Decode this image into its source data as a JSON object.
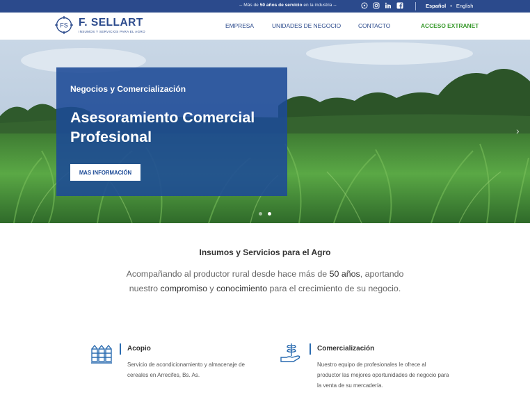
{
  "topbar": {
    "tagline_pre": "-- Más de",
    "tagline_bold": "50 años de servicio",
    "tagline_post": "en la industria --",
    "social": [
      "whatsapp-icon",
      "instagram-icon",
      "linkedin-icon",
      "facebook-icon"
    ],
    "lang_active": "Español",
    "lang_sep": "•",
    "lang_other": "English"
  },
  "header": {
    "logo_initials": "FS",
    "logo_name": "F. SELLART",
    "logo_sub": "INSUMOS Y SERVICIOS PARA EL AGRO",
    "nav": [
      "EMPRESA",
      "UNIDADES DE NEGOCIO",
      "CONTACTO",
      "ACCESO EXTRANET"
    ]
  },
  "hero": {
    "kicker": "Negocios y Comercialización",
    "title": "Asesoramiento Comercial Profesional",
    "button": "MAS INFORMACIÓN",
    "slide_count": 2,
    "active_slide": 1,
    "next_arrow": "›"
  },
  "intro": {
    "title": "Insumos y Servicios para el Agro",
    "t1": "Acompañando al productor rural desde hace más de ",
    "h1": "50 años",
    "t2": ", aportando nuestro ",
    "h2": "compromiso",
    "t3": " y ",
    "h3": "conocimiento",
    "t4": " para el crecimiento de su negocio."
  },
  "services": [
    {
      "icon": "silo-icon",
      "title": "Acopio",
      "desc": "Servicio de acondicionamiento y almacenaje de cereales en Arrecifes, Bs. As."
    },
    {
      "icon": "plant-hand-icon",
      "title": "Comercialización",
      "desc": "Nuestro equipo de profesionales le ofrece al productor las mejores oportunidades de negocio para la venta de su mercadería."
    }
  ],
  "colors": {
    "brand": "#2b4a8c",
    "extranet": "#3a9a2e",
    "hero_box": "#1c4a96"
  }
}
